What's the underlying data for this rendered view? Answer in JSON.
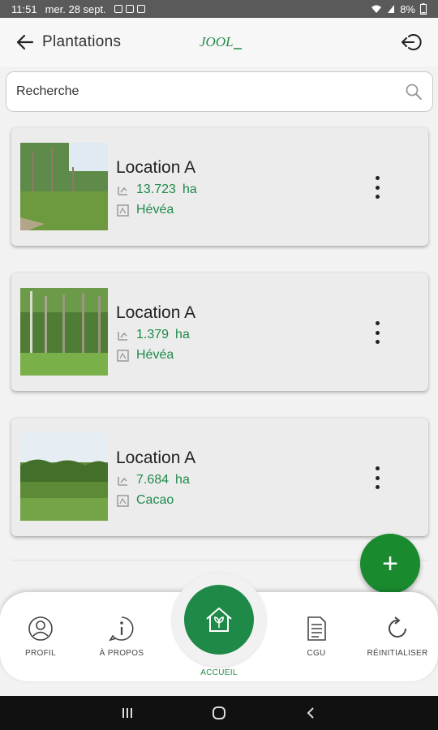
{
  "status_bar": {
    "time": "11:51",
    "date": "mer. 28 sept.",
    "battery": "8%"
  },
  "header": {
    "title": "Plantations",
    "logo_text": "JOOL"
  },
  "search": {
    "placeholder": "Recherche"
  },
  "plantations": [
    {
      "name": "Location A",
      "area": "13.723",
      "unit": "ha",
      "crop": "Hévéa"
    },
    {
      "name": "Location A",
      "area": "1.379",
      "unit": "ha",
      "crop": "Hévéa"
    },
    {
      "name": "Location A",
      "area": "7.684",
      "unit": "ha",
      "crop": "Cacao"
    }
  ],
  "fab": {
    "label": "+"
  },
  "bottom_nav": {
    "profil": "PROFIL",
    "apropos": "À PROPOS",
    "accueil": "ACCUEIL",
    "cgu": "CGU",
    "reinitialiser": "RÉINITIALISER"
  },
  "colors": {
    "accent": "#1f8a47",
    "fab": "#1a8a2e",
    "text_green": "#1e8a4a"
  },
  "icons": {
    "back": "arrow-left-icon",
    "logout": "logout-icon",
    "search": "search-icon",
    "area": "area-icon",
    "crop": "crop-icon",
    "menu": "more-vertical-icon",
    "profil": "user-icon",
    "apropos": "info-icon",
    "accueil": "eco-home-icon",
    "cgu": "document-icon",
    "reinitialiser": "refresh-icon"
  }
}
